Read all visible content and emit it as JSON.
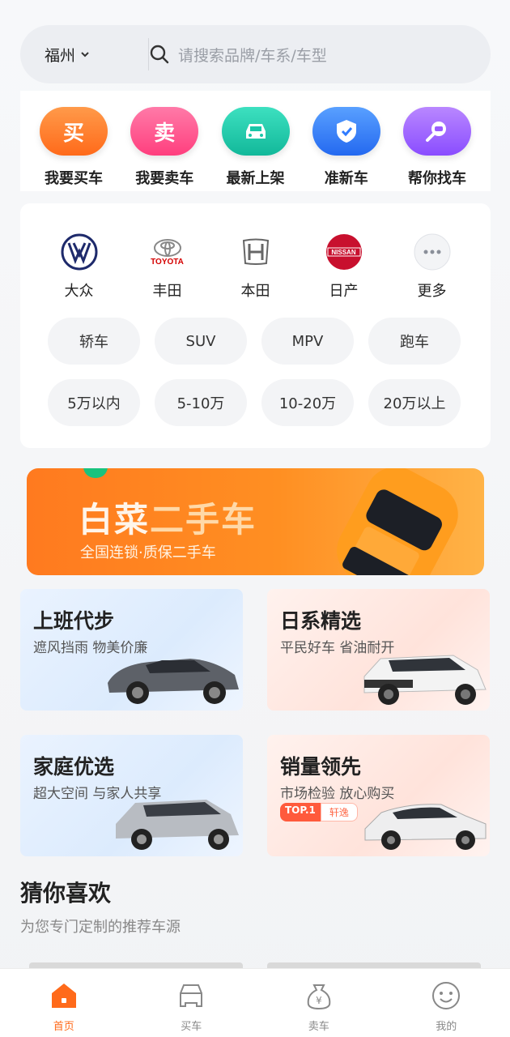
{
  "search": {
    "city": "福州",
    "placeholder": "请搜索品牌/车系/车型"
  },
  "quick_entries": [
    {
      "label": "我要买车",
      "glyph": "买",
      "color": "#ff7a2f"
    },
    {
      "label": "我要卖车",
      "glyph": "卖",
      "color": "#ff4f8b"
    },
    {
      "label": "最新上架",
      "icon": "car-icon",
      "color": "#19c7a8"
    },
    {
      "label": "准新车",
      "icon": "shield-badge-icon",
      "color": "#2f7bff"
    },
    {
      "label": "帮你找车",
      "icon": "search-car-icon",
      "color": "#9b5cff"
    }
  ],
  "brands": [
    {
      "label": "大众",
      "icon": "volkswagen-logo-icon"
    },
    {
      "label": "丰田",
      "icon": "toyota-logo-icon",
      "logo_text": "TOYOTA"
    },
    {
      "label": "本田",
      "icon": "honda-logo-icon"
    },
    {
      "label": "日产",
      "icon": "nissan-logo-icon",
      "logo_text": "NISSAN"
    },
    {
      "label": "更多",
      "icon": "more-dots-icon"
    }
  ],
  "body_types": [
    "轿车",
    "SUV",
    "MPV",
    "跑车"
  ],
  "price_ranges": [
    "5万以内",
    "5-10万",
    "10-20万",
    "20万以上"
  ],
  "banner": {
    "title_a": "白菜",
    "title_b": "二手车",
    "subtitle": "全国连锁·质保二手车"
  },
  "categories": [
    {
      "title": "上班代步",
      "subtitle": "遮风挡雨 物美价廉",
      "theme": "blue"
    },
    {
      "title": "日系精选",
      "subtitle": "平民好车 省油耐开",
      "theme": "pink"
    },
    {
      "title": "家庭优选",
      "subtitle": "超大空间 与家人共享",
      "theme": "blue"
    },
    {
      "title": "销量领先",
      "subtitle": "市场检验 放心购买",
      "theme": "pink",
      "badge_top": "TOP.1",
      "badge_text": "轩逸"
    }
  ],
  "recommend": {
    "title": "猜你喜欢",
    "subtitle": "为您专门定制的推荐车源"
  },
  "tabbar": [
    {
      "label": "首页",
      "icon": "home-icon",
      "active": true
    },
    {
      "label": "买车",
      "icon": "car-outline-icon",
      "active": false
    },
    {
      "label": "卖车",
      "icon": "money-bag-icon",
      "active": false
    },
    {
      "label": "我的",
      "icon": "smiley-face-icon",
      "active": false
    }
  ],
  "colors": {
    "accent": "#ff6a1a",
    "banner": "#ff8a22"
  }
}
